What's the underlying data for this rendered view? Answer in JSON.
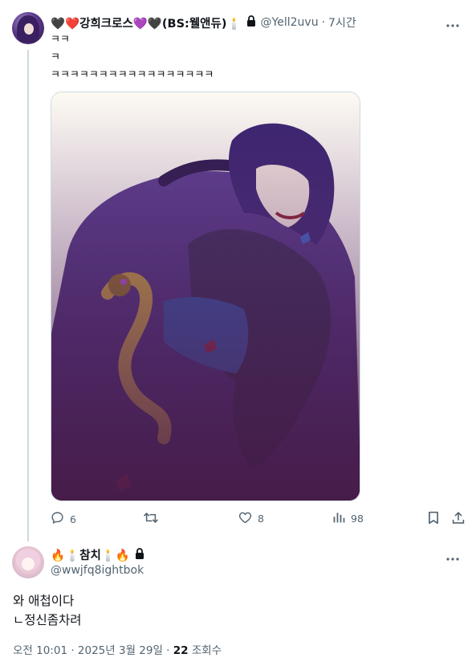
{
  "tweet1": {
    "author_name": "🖤❤️강희크로스💜🖤(BS:웰앤듀)🕯️",
    "lock_icon": "lock-icon",
    "handle": "@Yell2uvu",
    "separator": "·",
    "time": "7시간",
    "text_lines": [
      "ㅋㅋ",
      "ㅋ",
      "ㅋㅋㅋㅋㅋㅋㅋㅋㅋㅋㅋㅋㅋㅋㅋㅋㅋ"
    ],
    "actions": {
      "reply_count": "6",
      "retweet_count": "",
      "like_count": "8",
      "views_count": "98"
    }
  },
  "tweet2": {
    "author_name": "🔥🕯️참치🕯️🔥",
    "handle": "@wwjfq8ightbok",
    "text_lines": [
      "와 애첩이다",
      "ㄴ정신좀차려"
    ],
    "timestamp": "오전 10:01 · 2025년 3월 29일 · ",
    "views_number": "22",
    "views_label": " 조회수"
  },
  "colors": {
    "text_primary": "#0f1419",
    "text_secondary": "#536471",
    "thread_line": "#cfd9de",
    "art_purple": "#4a2a7c"
  },
  "icons": [
    "reply-icon",
    "retweet-icon",
    "like-icon",
    "views-icon",
    "bookmark-icon",
    "share-icon",
    "more-icon",
    "lock-icon"
  ]
}
